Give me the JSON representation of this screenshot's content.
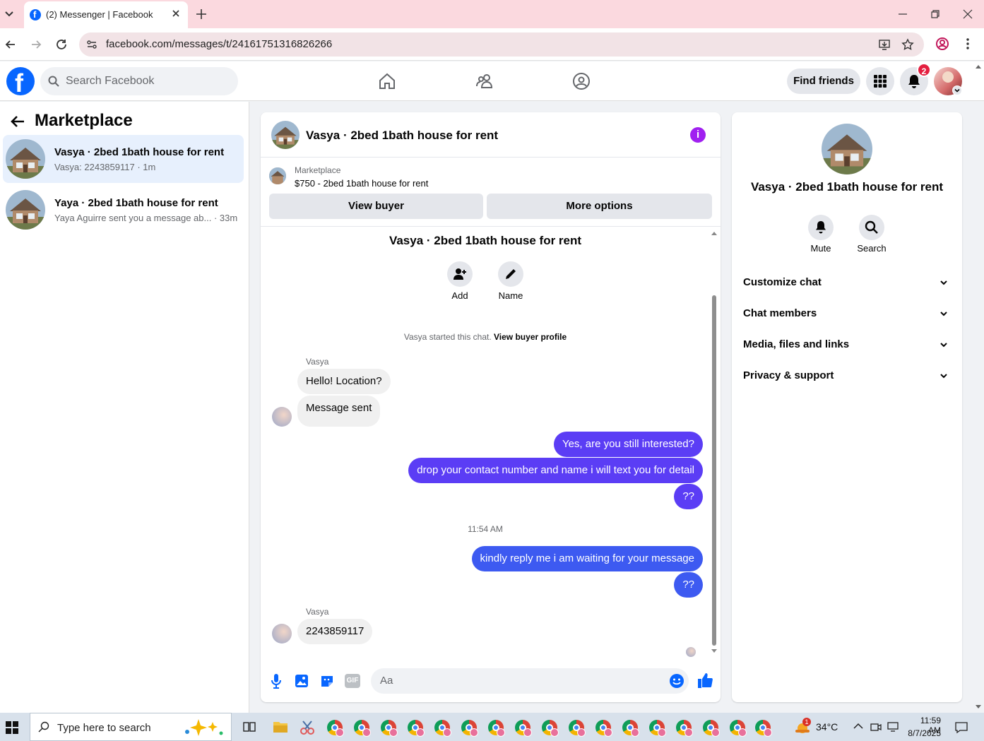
{
  "browser": {
    "tab_title": "(2) Messenger | Facebook",
    "url": "facebook.com/messages/t/24161751316826266"
  },
  "header": {
    "search_placeholder": "Search Facebook",
    "find_friends": "Find friends",
    "notification_count": "2",
    "brand_color": "#0866ff"
  },
  "sidebar": {
    "title": "Marketplace",
    "conversations": [
      {
        "name": "Vasya · 2bed 1bath house for rent",
        "preview": "Vasya: 2243859117 · 1m"
      },
      {
        "name": "Yaya · 2bed 1bath house for rent",
        "preview": "Yaya Aguirre sent you a message ab... · 33m"
      }
    ]
  },
  "chat": {
    "title": "Vasya · 2bed 1bath house for rent",
    "listing_source": "Marketplace",
    "listing_text": "$750 - 2bed 1bath house for rent",
    "view_buyer": "View buyer",
    "more_options": "More options",
    "intro_title": "Vasya · 2bed 1bath house for rent",
    "add_label": "Add",
    "name_label": "Name",
    "started_text": "Vasya started this chat.",
    "view_buyer_profile": "View buyer profile",
    "sender_1": "Vasya",
    "msg_in_1": "Hello! Location?",
    "msg_in_2": "Message sent",
    "msg_out_1": "Yes, are you still interested?",
    "msg_out_2": "drop your contact number and name i will text you for detail",
    "msg_out_3": "??",
    "timestamp": "11:54 AM",
    "msg_out_4": "kindly reply me i am waiting for your message",
    "msg_out_5": "??",
    "sender_2": "Vasya",
    "msg_in_3": "2243859117",
    "composer_placeholder": "Aa",
    "accent_color": "#5b3df5"
  },
  "info": {
    "title": "Vasya · 2bed 1bath house for rent",
    "mute": "Mute",
    "search": "Search",
    "sections": [
      "Customize chat",
      "Chat members",
      "Media, files and links",
      "Privacy & support"
    ]
  },
  "taskbar": {
    "search_placeholder": "Type here to search",
    "temperature": "34°C",
    "time": "11:59 AM",
    "date": "8/7/2025",
    "weather_badge": "1"
  }
}
